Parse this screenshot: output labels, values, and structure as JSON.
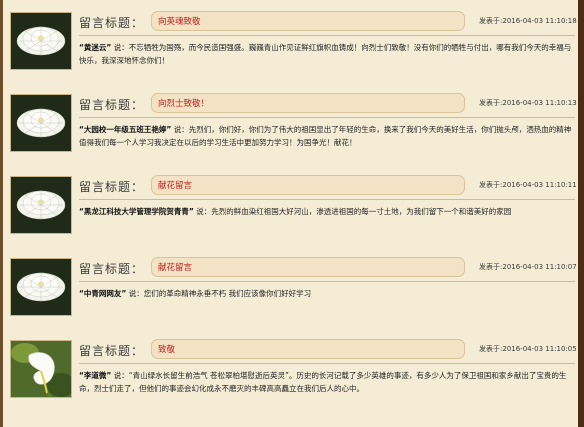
{
  "title_label": "留言标题：",
  "posted_prefix": "发表于:",
  "messages": [
    {
      "title": "向英魂致敬",
      "posted_at": "2016-04-03 11:10:18",
      "author": "“黄迷云”",
      "said": "说：",
      "content": "不忘牺牲为国殇，而今民造国强盛。巍巍青山作见证鲜红旗帜血铸成！向烈士们致敬！没有你们的牺牲与付出，哪有我们今天的幸福与快乐，我深深地怀念你们！"
    },
    {
      "title": "向烈士致敬！",
      "posted_at": "2016-04-03 11:10:13",
      "author": "“大园校一年级五班王艳婷”",
      "said": "说：",
      "content": "先烈们，你们好，你们为了伟大的祖国显出了年轻的生命，换来了我们今天的美好生活，你们抛头颅，洒热血的精神值得我们每一个人学习我决定在以后的学习生活中更加努力学习！为国争光！献花！"
    },
    {
      "title": "献花留言",
      "posted_at": "2016-04-03 11:10:11",
      "author": "“黑龙江科技大学管理学院贺青青”",
      "said": "说：",
      "content": "先烈的鲜血染红祖国大好河山，渗透进祖国的每一寸土地，为我们留下一个和谐美好的家园"
    },
    {
      "title": "献花留言",
      "posted_at": "2016-04-03 11:10:07",
      "author": "“中青网网友”",
      "said": "说：",
      "content": "您们的革命精神永垂不朽 我们应该像你们好好学习"
    },
    {
      "title": "致敬",
      "posted_at": "2016-04-03 11:10:05",
      "author": "“李道微”",
      "said": "说：",
      "content": "“青山绿水长留生前浩气 苍松翠柏堪慰逝后英灵”。历史的长河记载了多少英雄的事迹，有多少人为了保卫祖国和家乡献出了宝贵的生命，烈士们走了，但他们的事迹会幻化成永不磨灭的丰碑高高矗立在我们后人的心中。"
    }
  ],
  "flowers": [
    "white-chrysanthemum",
    "white-chrysanthemum",
    "white-chrysanthemum",
    "white-chrysanthemum",
    "white-calla-lily"
  ]
}
